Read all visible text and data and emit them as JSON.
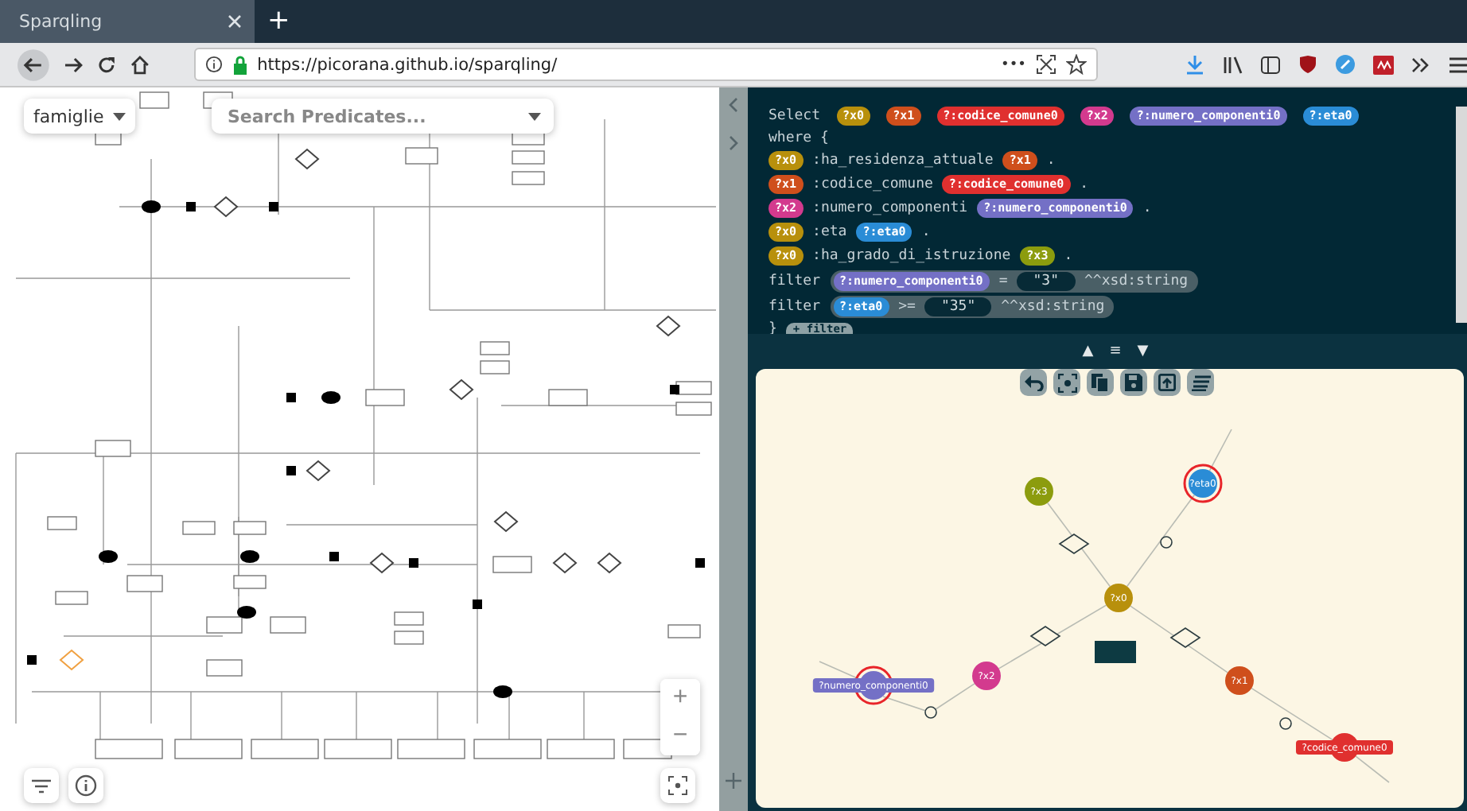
{
  "browser": {
    "tab_title": "Sparqling",
    "new_tab": "+",
    "url": "https://picorana.github.io/sparqling/",
    "page_actions": "•••"
  },
  "diagram": {
    "class_select": "famiglie",
    "search": {
      "placeholder": "Search Predicates..."
    },
    "zoom_in": "+",
    "zoom_out": "−"
  },
  "query": {
    "select_keyword": "Select",
    "where_keyword": "where {",
    "closing": "}",
    "add_filter": "+ filter",
    "variables": [
      {
        "label": "?x0",
        "color": "#b8900c"
      },
      {
        "label": "?x1",
        "color": "#cf4f1c"
      },
      {
        "label": "?:codice_comune0",
        "color": "#e0302f"
      },
      {
        "label": "?x2",
        "color": "#d33a8e"
      },
      {
        "label": "?:numero_componenti0",
        "color": "#7470c6"
      },
      {
        "label": "?:eta0",
        "color": "#2a8cd6"
      }
    ],
    "triples": [
      {
        "subject": {
          "label": "?x0",
          "color": "#b8900c"
        },
        "predicate": ":ha_residenza_attuale",
        "object": {
          "label": "?x1",
          "color": "#cf4f1c"
        },
        "end": "."
      },
      {
        "subject": {
          "label": "?x1",
          "color": "#cf4f1c"
        },
        "predicate": ":codice_comune",
        "object": {
          "label": "?:codice_comune0",
          "color": "#e0302f"
        },
        "end": "."
      },
      {
        "subject": {
          "label": "?x2",
          "color": "#d33a8e"
        },
        "predicate": ":numero_componenti",
        "object": {
          "label": "?:numero_componenti0",
          "color": "#7470c6"
        },
        "end": "."
      },
      {
        "subject": {
          "label": "?x0",
          "color": "#b8900c"
        },
        "predicate": ":eta",
        "object": {
          "label": "?:eta0",
          "color": "#2a8cd6"
        },
        "end": "."
      },
      {
        "subject": {
          "label": "?x0",
          "color": "#b8900c"
        },
        "predicate": ":ha_grado_di_istruzione",
        "object": {
          "label": "?x3",
          "color": "#8c9c0e"
        },
        "end": "."
      }
    ],
    "filters": [
      {
        "keyword": "filter",
        "variable": {
          "label": "?:numero_componenti0",
          "color": "#7470c6"
        },
        "operator": "=",
        "value": "\"3\"",
        "datatype": "^^xsd:string"
      },
      {
        "keyword": "filter",
        "variable": {
          "label": "?:eta0",
          "color": "#2a8cd6"
        },
        "operator": ">=",
        "value": "\"35\"",
        "datatype": "^^xsd:string"
      }
    ]
  },
  "graph": {
    "nav": [
      "▲",
      "≡",
      "▼"
    ],
    "nodes": [
      {
        "label": "?x0",
        "color": "#b8900c",
        "selected": false
      },
      {
        "label": "?x3",
        "color": "#8c9c0e",
        "selected": false
      },
      {
        "label": "?eta0",
        "color": "#2a8cd6",
        "selected": true
      },
      {
        "label": "?x2",
        "color": "#d33a8e",
        "selected": false
      },
      {
        "label": "?numero_componenti0",
        "color": "#7470c6",
        "selected": true
      },
      {
        "label": "?x1",
        "color": "#cf4f1c",
        "selected": false
      },
      {
        "label": "?codice_comune0",
        "color": "#e0302f",
        "selected": false
      }
    ]
  }
}
